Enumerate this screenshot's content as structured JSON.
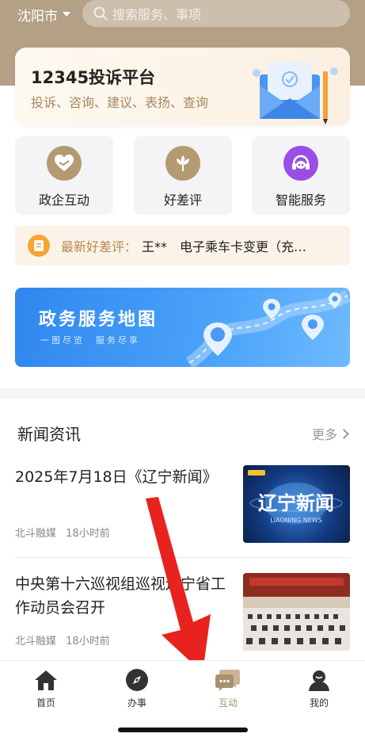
{
  "header": {
    "city": "沈阳市",
    "search_placeholder": "搜索服务、事项"
  },
  "complaint_card": {
    "title": "12345投诉平台",
    "subtitle": "投诉、咨询、建议、表扬、查询"
  },
  "tiles": [
    {
      "label": "政企互动",
      "icon": "handshake-heart-icon",
      "color": "#b49a70"
    },
    {
      "label": "好差评",
      "icon": "flower-icon",
      "color": "#b49a70"
    },
    {
      "label": "智能服务",
      "icon": "headset-robot-icon",
      "color": "#9a4ee6"
    }
  ],
  "review_bar": {
    "label": "最新好差评：",
    "text": "王**　电子乘车卡变更（充…"
  },
  "map_banner": {
    "title": "政务服务地图",
    "subtitle": "一图尽览　服务尽享"
  },
  "news": {
    "section_title": "新闻资讯",
    "more_label": "更多",
    "items": [
      {
        "title": "2025年7月18日《辽宁新闻》",
        "source": "北斗融媒",
        "time": "18小时前"
      },
      {
        "title": "中央第十六巡视组巡视辽宁省工作动员会召开",
        "source": "北斗融媒",
        "time": "18小时前"
      }
    ]
  },
  "thumbnails": {
    "first_logo_text": "辽宁新闻",
    "first_logo_sub": "LIAONING NEWS"
  },
  "bottom_nav": [
    {
      "label": "首页",
      "icon": "home-icon"
    },
    {
      "label": "办事",
      "icon": "compass-icon"
    },
    {
      "label": "互动",
      "icon": "chat-bubbles-icon",
      "active": true
    },
    {
      "label": "我的",
      "icon": "user-icon"
    }
  ],
  "colors": {
    "header_bg": "#b4a085",
    "accent_gold": "#a6906f",
    "map_blue": "#2f87ef",
    "annotation_red": "#e8221e"
  }
}
